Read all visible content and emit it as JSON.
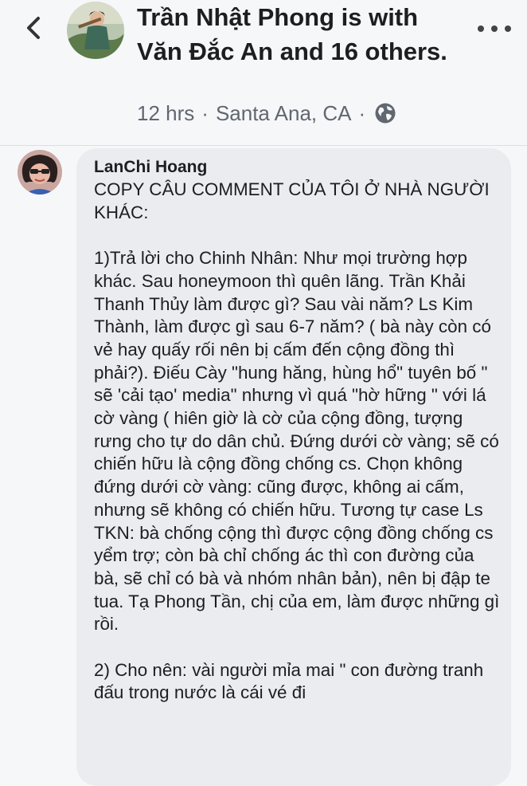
{
  "header": {
    "title": "Trần Nhật Phong is with Văn Đắc An and 16 others.",
    "time": "12 hrs",
    "separator": "·",
    "location": "Santa Ana, CA",
    "privacy_icon": "globe-icon",
    "back_icon": "chevron-left-icon",
    "more_icon": "more-horizontal-icon"
  },
  "comment": {
    "author": "LanChi Hoang",
    "paragraphs": [
      "COPY CÂU COMMENT CỦA TÔI Ở NHÀ NGƯỜI KHÁC:",
      "1)Trả lời cho Chinh Nhân:  Như mọi trường hợp khác. Sau honeymoon thì quên lãng. Trần Khải Thanh Thủy làm được gì? Sau vài năm? Ls Kim Thành, làm được gì sau 6-7 năm? ( bà này còn có vẻ hay quấy rối nên bị cấm đến cộng đồng thì phải?). Điếu Cày \"hung hăng, hùng hổ\" tuyên bố \" sẽ 'cải tạo' media\" nhưng vì quá \"hờ hững \" với lá cờ vàng ( hiên giờ là cờ của cộng đồng, tượng rưng cho tự do dân chủ. Đứng dưới cờ vàng; sẽ có chiến hữu là cộng đồng chống cs. Chọn không đứng dưới cờ vàng: cũng được, không ai cấm, nhưng sẽ không có chiến hữu. Tương tự case Ls TKN: bà chống cộng thì được cộng đồng chống cs yểm trợ; còn bà chỉ chống ác thì con đường của bà, sẽ chỉ có bà và nhóm nhân bản), nên bị đập te tua. Tạ Phong Tần, chị của em, làm được những gì rồi.",
      "2) Cho nên: vài người mỉa mai \" con đường tranh đấu trong nước là cái vé đi"
    ]
  },
  "colors": {
    "background": "#f6f7f9",
    "bubble": "#ebecef",
    "text": "#1c1e21",
    "meta_text": "#606770"
  }
}
